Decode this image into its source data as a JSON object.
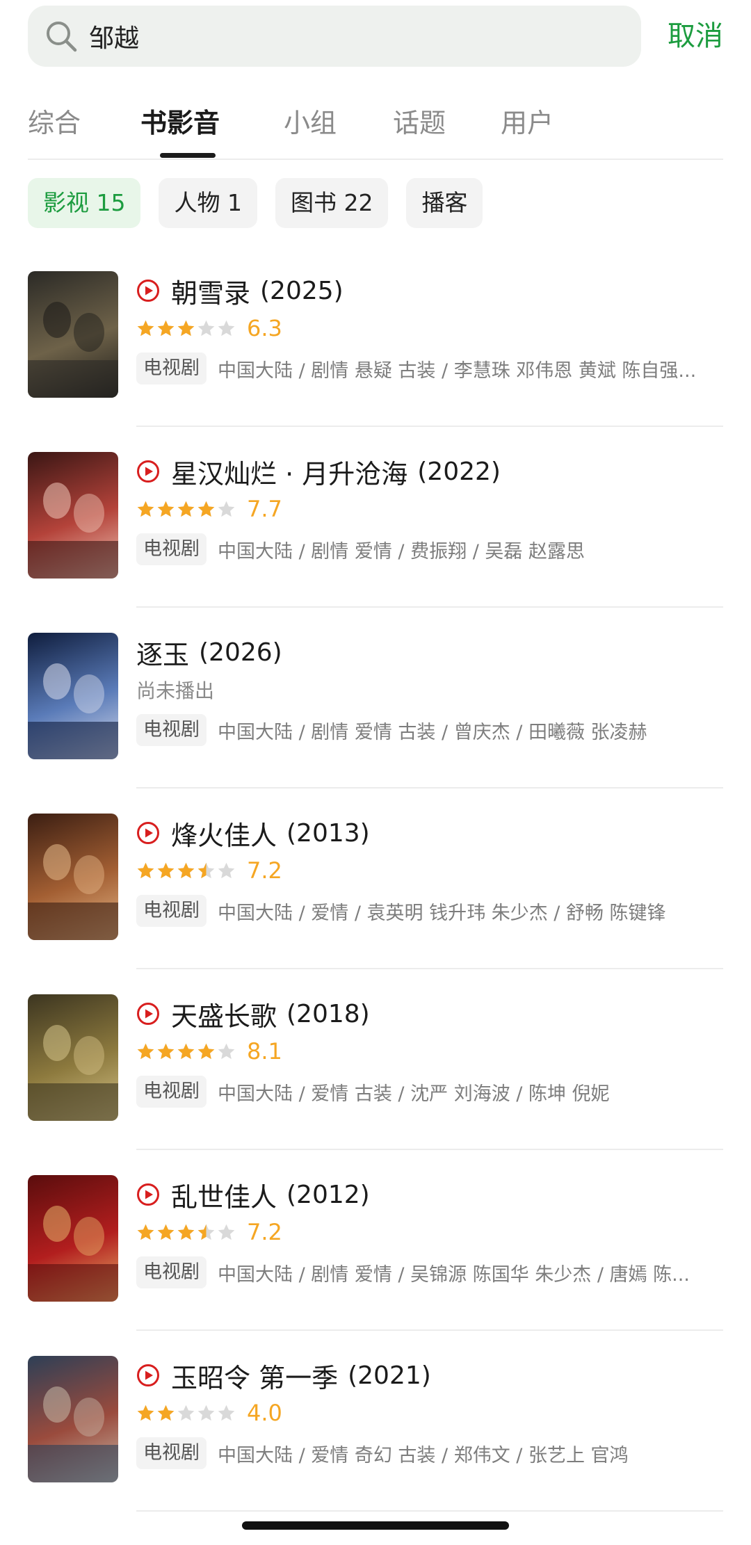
{
  "search": {
    "query": "邹越",
    "cancel_label": "取消"
  },
  "tabs": [
    {
      "label": "综合",
      "active": false
    },
    {
      "label": "书影音",
      "active": true
    },
    {
      "label": "小组",
      "active": false
    },
    {
      "label": "话题",
      "active": false
    },
    {
      "label": "用户",
      "active": false
    }
  ],
  "filters": [
    {
      "label": "影视 15",
      "active": true
    },
    {
      "label": "人物 1",
      "active": false
    },
    {
      "label": "图书 22",
      "active": false
    },
    {
      "label": "播客",
      "active": false
    }
  ],
  "colors": {
    "accent": "#1c9c3f",
    "star": "#f5a623",
    "star_empty": "#d9d9d9",
    "play": "#d81e1e"
  },
  "results": [
    {
      "title": "朝雪录",
      "year": "(2025)",
      "playable": true,
      "stars": 3,
      "score": "6.3",
      "status": "",
      "type_tag": "电视剧",
      "meta": "中国大陆 / 剧情 悬疑 古装 / 李慧珠 邓伟恩 黄斌 陈自强...",
      "poster_colors": [
        "#2b2a26",
        "#6e6249",
        "#1b1a18"
      ]
    },
    {
      "title": "星汉灿烂 · 月升沧海",
      "year": "(2022)",
      "playable": true,
      "stars": 4,
      "score": "7.7",
      "status": "",
      "type_tag": "电视剧",
      "meta": "中国大陆 / 剧情 爱情 / 费振翔 / 吴磊 赵露思",
      "poster_colors": [
        "#3a1614",
        "#b4433a",
        "#f0c7b8"
      ]
    },
    {
      "title": "逐玉",
      "year": "(2026)",
      "playable": false,
      "stars": 0,
      "score": "",
      "status": "尚未播出",
      "type_tag": "电视剧",
      "meta": "中国大陆 / 剧情 爱情 古装 / 曾庆杰 / 田曦薇 张凌赫",
      "poster_colors": [
        "#0f1d3d",
        "#5a7bb8",
        "#d8dcec"
      ]
    },
    {
      "title": "烽火佳人",
      "year": "(2013)",
      "playable": true,
      "stars": 3.5,
      "score": "7.2",
      "status": "",
      "type_tag": "电视剧",
      "meta": "中国大陆 / 爱情 / 袁英明 钱升玮 朱少杰 / 舒畅 陈键锋",
      "poster_colors": [
        "#3b1e12",
        "#a35f33",
        "#e6b98a"
      ]
    },
    {
      "title": "天盛长歌",
      "year": "(2018)",
      "playable": true,
      "stars": 4,
      "score": "8.1",
      "status": "",
      "type_tag": "电视剧",
      "meta": "中国大陆 / 爱情 古装 / 沈严 刘海波 / 陈坤 倪妮",
      "poster_colors": [
        "#3c3520",
        "#8d7a3e",
        "#d6c48a"
      ]
    },
    {
      "title": "乱世佳人",
      "year": "(2012)",
      "playable": true,
      "stars": 3.5,
      "score": "7.2",
      "status": "",
      "type_tag": "电视剧",
      "meta": "中国大陆 / 剧情 爱情 / 吴锦源 陈国华 朱少杰 / 唐嫣 陈...",
      "poster_colors": [
        "#5a0d0d",
        "#b21e1e",
        "#e8b36a"
      ]
    },
    {
      "title": "玉昭令 第一季",
      "year": "(2021)",
      "playable": true,
      "stars": 2,
      "score": "4.0",
      "status": "",
      "type_tag": "电视剧",
      "meta": "中国大陆 / 爱情 奇幻 古装 / 郑伟文 / 张艺上 官鸿",
      "poster_colors": [
        "#2d3f56",
        "#9a4b3d",
        "#c9b9a8"
      ]
    }
  ]
}
